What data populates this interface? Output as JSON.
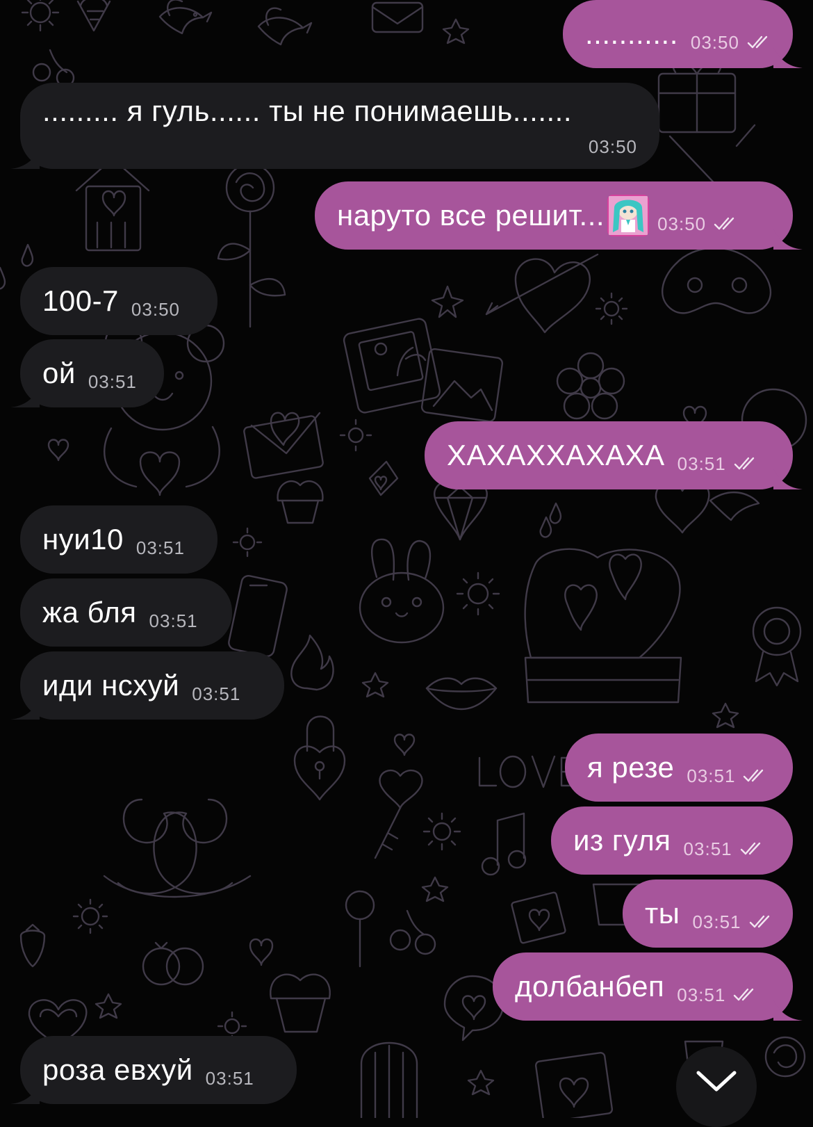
{
  "messages": [
    {
      "id": 1,
      "direction": "outgoing",
      "text": "...........",
      "time": "03:50",
      "status": "read"
    },
    {
      "id": 2,
      "direction": "incoming",
      "text": "......... я гуль...... ты не понимаешь.......",
      "time": "03:50"
    },
    {
      "id": 3,
      "direction": "outgoing",
      "text": "наруто все решит...",
      "time": "03:50",
      "status": "read",
      "emoji": "sticker-girl-icon"
    },
    {
      "id": 4,
      "direction": "incoming",
      "text": "100-7",
      "time": "03:50"
    },
    {
      "id": 5,
      "direction": "incoming",
      "text": "ой",
      "time": "03:51"
    },
    {
      "id": 6,
      "direction": "outgoing",
      "text": "ХАХАХХАХАХА",
      "time": "03:51",
      "status": "read"
    },
    {
      "id": 7,
      "direction": "incoming",
      "text": "нуи10",
      "time": "03:51"
    },
    {
      "id": 8,
      "direction": "incoming",
      "text": "жа бля",
      "time": "03:51"
    },
    {
      "id": 9,
      "direction": "incoming",
      "text": "иди нсхуй",
      "time": "03:51"
    },
    {
      "id": 10,
      "direction": "outgoing",
      "text": "я резе",
      "time": "03:51",
      "status": "read"
    },
    {
      "id": 11,
      "direction": "outgoing",
      "text": "из гуля",
      "time": "03:51",
      "status": "read"
    },
    {
      "id": 12,
      "direction": "outgoing",
      "text": "ты",
      "time": "03:51",
      "status": "read"
    },
    {
      "id": 13,
      "direction": "outgoing",
      "text": "долбанбеп",
      "time": "03:51",
      "status": "read"
    },
    {
      "id": 14,
      "direction": "incoming",
      "text": "роза евхуй",
      "time": "03:51"
    }
  ],
  "scroll_down_button": {
    "icon": "chevron-down-icon"
  },
  "wallpaper_icons": [
    "bird-icon",
    "rose-icon",
    "heart-arrow-icon",
    "photo-icon",
    "envelope-icon",
    "bunny-icon",
    "cake-icon",
    "swans-icon",
    "lock-icon",
    "key-icon",
    "rings-icon",
    "cupcake-icon",
    "ice-cream-icon",
    "gift-icon"
  ],
  "colors": {
    "background": "#050505",
    "incoming_bubble": "#1c1c1f",
    "outgoing_bubble": "#a7559b",
    "wallpaper_line": "#403a48"
  }
}
